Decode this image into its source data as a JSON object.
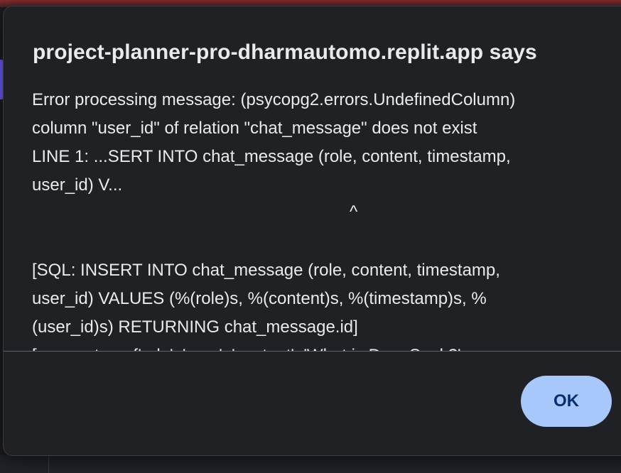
{
  "dialog": {
    "title": "project-planner-pro-dharmautomo.replit.app says",
    "message_lines": [
      "Error processing message: (psycopg2.errors.UndefinedColumn)",
      "column \"user_id\" of relation \"chat_message\" does not exist",
      "LINE 1: ...SERT INTO chat_message (role, content, timestamp,",
      "user_id) V...",
      "^",
      "[SQL: INSERT INTO chat_message (role, content, timestamp,",
      "user_id) VALUES (%(role)s, %(content)s, %(timestamp)s, %",
      "(user_id)s) RETURNING chat_message.id]",
      "[parameters: {'role': 'user', 'content': 'What is DeepSeek?',"
    ],
    "ok_label": "OK"
  },
  "colors": {
    "dialog_background": "#202124",
    "text": "#e8eaed",
    "button_background": "#a8c7fa",
    "button_text": "#062e6f"
  }
}
